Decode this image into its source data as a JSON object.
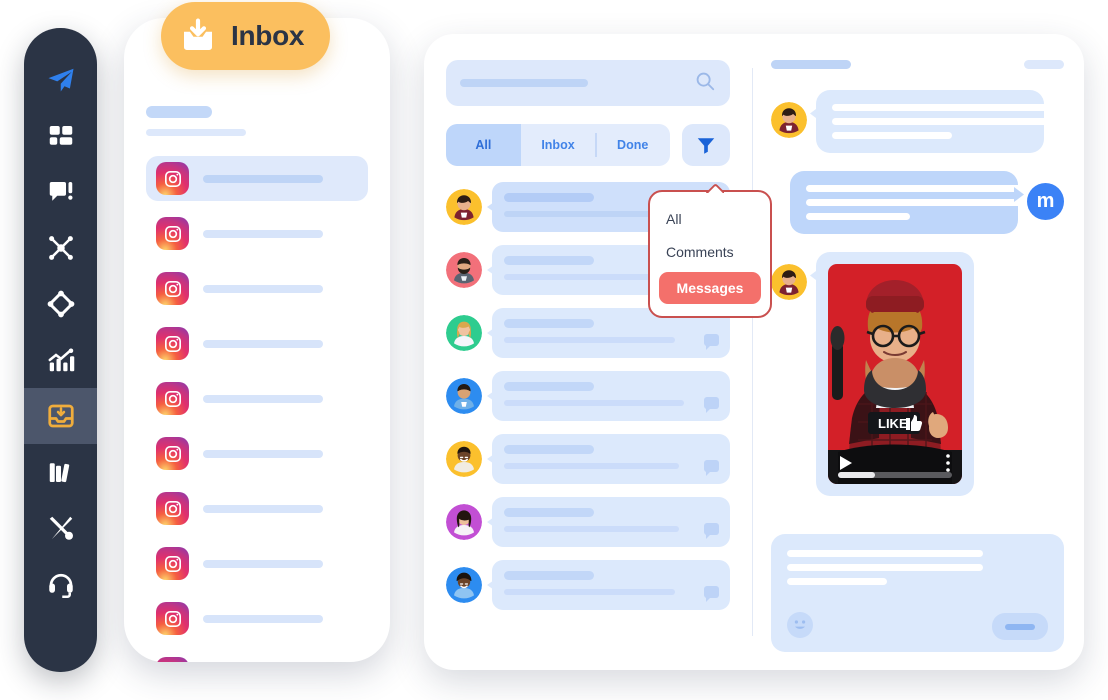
{
  "sidebar": {
    "items": [
      {
        "name": "send-icon",
        "label": "Publish",
        "active": false
      },
      {
        "name": "dashboard-icon",
        "label": "Dashboard",
        "active": false
      },
      {
        "name": "engage-icon",
        "label": "Engage",
        "active": false
      },
      {
        "name": "network-icon",
        "label": "Network",
        "active": false
      },
      {
        "name": "listen-icon",
        "label": "Listen",
        "active": false
      },
      {
        "name": "analytics-icon",
        "label": "Analytics",
        "active": false
      },
      {
        "name": "inbox-icon",
        "label": "Inbox",
        "active": true
      },
      {
        "name": "library-icon",
        "label": "Library",
        "active": false
      },
      {
        "name": "tools-icon",
        "label": "Tools",
        "active": false
      },
      {
        "name": "support-icon",
        "label": "Support",
        "active": false
      }
    ],
    "active_color": "#4c566b",
    "background": "#2b3445"
  },
  "badge": {
    "label": "Inbox",
    "icon": "inbox-download-icon",
    "background": "#fbbf5f",
    "text_color": "#2b3445"
  },
  "phone": {
    "list_items": [
      {
        "icon": "instagram-icon",
        "selected": true
      },
      {
        "icon": "instagram-icon",
        "selected": false
      },
      {
        "icon": "instagram-icon",
        "selected": false
      },
      {
        "icon": "instagram-icon",
        "selected": false
      },
      {
        "icon": "instagram-icon",
        "selected": false
      },
      {
        "icon": "instagram-icon",
        "selected": false
      },
      {
        "icon": "instagram-icon",
        "selected": false
      },
      {
        "icon": "instagram-icon",
        "selected": false
      },
      {
        "icon": "instagram-icon",
        "selected": false
      },
      {
        "icon": "instagram-icon",
        "selected": false
      }
    ]
  },
  "main": {
    "search": {
      "placeholder": "",
      "icon": "search-icon"
    },
    "tabs": [
      {
        "label": "All",
        "active": true
      },
      {
        "label": "Inbox",
        "active": false
      },
      {
        "label": "Done",
        "active": false
      }
    ],
    "filter_button": {
      "icon": "filter-funnel-icon",
      "color": "#1a63d8"
    },
    "dropdown": {
      "border_color": "#c9504f",
      "items": [
        {
          "label": "All",
          "selected": false
        },
        {
          "label": "Comments",
          "selected": false
        },
        {
          "label": "Messages",
          "selected": true
        }
      ],
      "selected_color": "#f4706b"
    },
    "conversations": [
      {
        "avatar": "avatar-curly-man",
        "avatar_bg": "#fbc02d",
        "has_tag": false,
        "bubble": "dark"
      },
      {
        "avatar": "avatar-bearded-man",
        "avatar_bg": "#f2707a",
        "has_tag": false,
        "bubble": "light"
      },
      {
        "avatar": "avatar-blonde-woman",
        "avatar_bg": "#2ecc8f",
        "has_tag": true,
        "bubble": "light"
      },
      {
        "avatar": "avatar-young-man",
        "avatar_bg": "#2d8cf0",
        "has_tag": true,
        "bubble": "light"
      },
      {
        "avatar": "avatar-smiling-man",
        "avatar_bg": "#fbc02d",
        "has_tag": true,
        "bubble": "light"
      },
      {
        "avatar": "avatar-asian-woman",
        "avatar_bg": "#c24fd4",
        "has_tag": true,
        "bubble": "light"
      },
      {
        "avatar": "avatar-short-hair-woman",
        "avatar_bg": "#2d8cf0",
        "has_tag": true,
        "bubble": "light"
      }
    ]
  },
  "chat": {
    "header": {
      "title_placeholder": "",
      "action_placeholder": ""
    },
    "messages": [
      {
        "type": "incoming",
        "avatar": "avatar-curly-man",
        "avatar_bg": "#fbc02d",
        "lines": 3
      },
      {
        "type": "outgoing",
        "avatar": "brand-m-badge",
        "badge_letter": "m",
        "badge_color": "#3b82f6",
        "lines": 3
      },
      {
        "type": "media",
        "avatar": "avatar-curly-man",
        "avatar_bg": "#fbc02d",
        "media": {
          "name": "video-thumbnail",
          "description": "Woman in red beanie and plaid shirt holding LIKE sign",
          "background": "#d32028",
          "controls": {
            "play": "play-icon",
            "menu": "more-vertical-icon",
            "progress": 32
          }
        }
      }
    ],
    "composer": {
      "placeholder": "",
      "emoji_button": "smiley-icon",
      "send_button": "send-button"
    }
  }
}
